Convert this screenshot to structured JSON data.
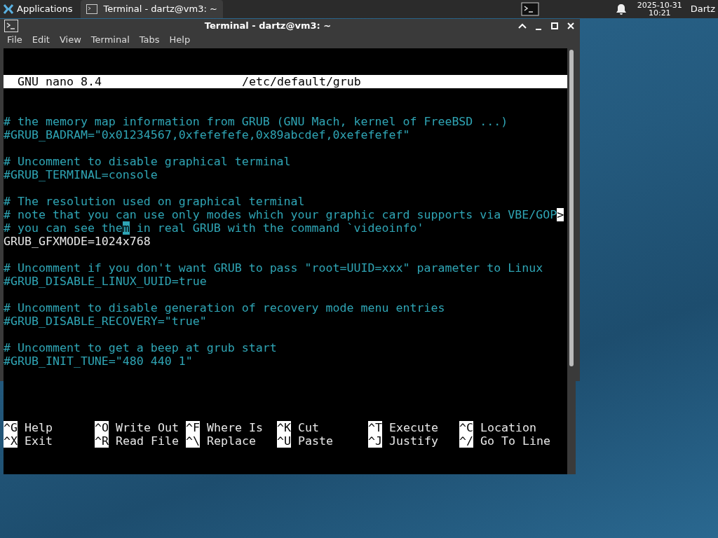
{
  "panel": {
    "applications": "Applications",
    "tasks": [
      {
        "label": "Terminal - dartz@vm3: ~",
        "selected": true
      }
    ],
    "date": "2025-10-31",
    "time": "10:21",
    "user": "Dartz"
  },
  "window": {
    "title": "Terminal - dartz@vm3: ~",
    "menu": [
      "File",
      "Edit",
      "View",
      "Terminal",
      "Tabs",
      "Help"
    ]
  },
  "nano": {
    "version": "GNU nano 8.4",
    "file": "/etc/default/grub",
    "lines": [
      {
        "kind": "comment",
        "text": "# the memory map information from GRUB (GNU Mach, kernel of FreeBSD ...)"
      },
      {
        "kind": "comment",
        "text": "#GRUB_BADRAM=\"0x01234567,0xfefefefe,0x89abcdef,0xefefefef\""
      },
      {
        "kind": "blank"
      },
      {
        "kind": "comment",
        "text": "# Uncomment to disable graphical terminal"
      },
      {
        "kind": "comment",
        "text": "#GRUB_TERMINAL=console"
      },
      {
        "kind": "blank"
      },
      {
        "kind": "comment",
        "text": "# The resolution used on graphical terminal"
      },
      {
        "kind": "comment",
        "text": "# note that you can use only modes which your graphic card supports via VBE/GOP",
        "overflow": ">"
      },
      {
        "kind": "comment",
        "text": "# you can see the",
        "cursor": "m",
        "after": " in real GRUB with the command `videoinfo'"
      },
      {
        "kind": "setting",
        "text": "GRUB_GFXMODE=1024x768"
      },
      {
        "kind": "blank"
      },
      {
        "kind": "comment",
        "text": "# Uncomment if you don't want GRUB to pass \"root=UUID=xxx\" parameter to Linux"
      },
      {
        "kind": "comment",
        "text": "#GRUB_DISABLE_LINUX_UUID=true"
      },
      {
        "kind": "blank"
      },
      {
        "kind": "comment",
        "text": "# Uncomment to disable generation of recovery mode menu entries"
      },
      {
        "kind": "comment",
        "text": "#GRUB_DISABLE_RECOVERY=\"true\""
      },
      {
        "kind": "blank"
      },
      {
        "kind": "comment",
        "text": "# Uncomment to get a beep at grub start"
      },
      {
        "kind": "comment",
        "text": "#GRUB_INIT_TUNE=\"480 440 1\""
      },
      {
        "kind": "blank"
      },
      {
        "kind": "blank"
      }
    ],
    "shortcuts": [
      [
        {
          "key": "^G",
          "label": "Help"
        },
        {
          "key": "^O",
          "label": "Write Out"
        },
        {
          "key": "^F",
          "label": "Where Is"
        },
        {
          "key": "^K",
          "label": "Cut"
        },
        {
          "key": "^T",
          "label": "Execute"
        },
        {
          "key": "^C",
          "label": "Location"
        }
      ],
      [
        {
          "key": "^X",
          "label": "Exit"
        },
        {
          "key": "^R",
          "label": "Read File"
        },
        {
          "key": "^\\",
          "label": "Replace"
        },
        {
          "key": "^U",
          "label": "Paste"
        },
        {
          "key": "^J",
          "label": "Justify"
        },
        {
          "key": "^/",
          "label": "Go To Line"
        }
      ]
    ]
  }
}
